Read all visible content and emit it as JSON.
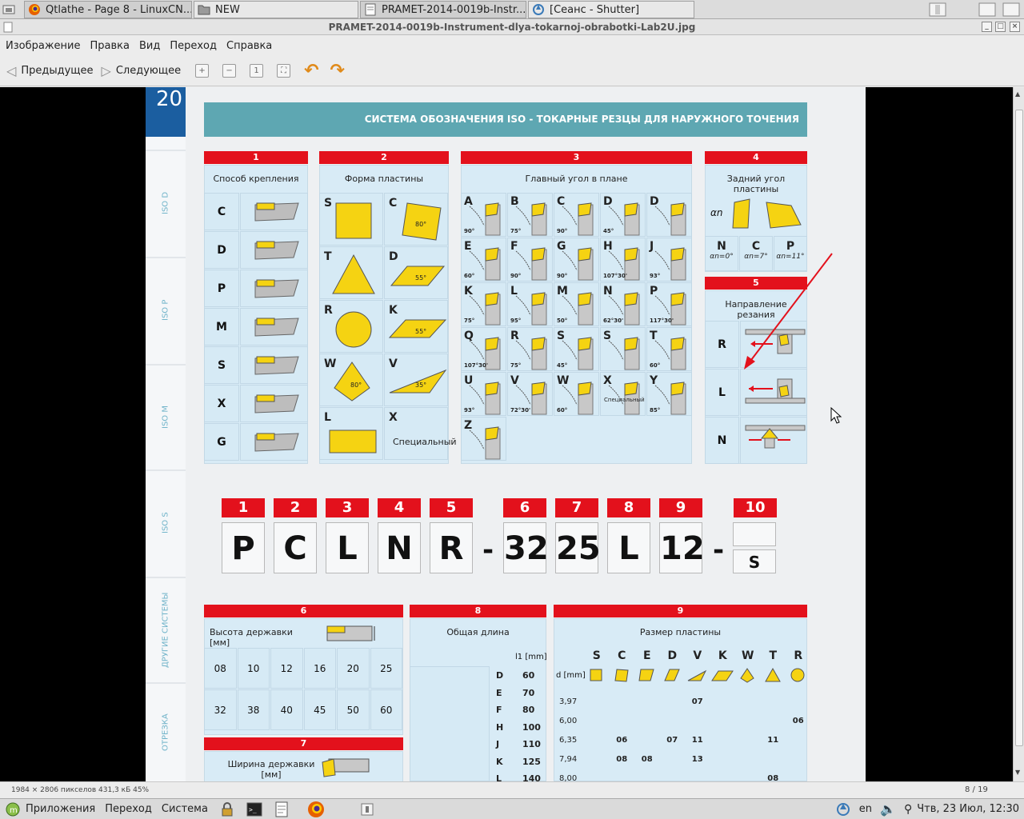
{
  "taskbar_top": {
    "tabs": [
      {
        "label": "Qtlathe - Page 8 - LinuxCN...",
        "icon": "firefox-icon"
      },
      {
        "label": "NEW",
        "icon": "folder-icon"
      },
      {
        "label": "PRAMET-2014-0019b-Instr...",
        "icon": "document-icon"
      },
      {
        "label": "[Сеанс - Shutter]",
        "icon": "shutter-icon"
      }
    ]
  },
  "window": {
    "title": "PRAMET-2014-0019b-Instrument-dlya-tokarnoj-obrabotki-Lab2U.jpg"
  },
  "menu": [
    "Изображение",
    "Правка",
    "Вид",
    "Переход",
    "Справка"
  ],
  "toolbar": {
    "prev_label": "Предыдущее",
    "next_label": "Следующее"
  },
  "status": {
    "info": "1984 × 2806 пикселов  431,3 кБ   45%",
    "page": "8 / 19"
  },
  "bottom_panel": {
    "apps": "Приложения",
    "places": "Переход",
    "system": "Система",
    "lang": "en",
    "datetime": "Чтв, 23 Июл, 12:30"
  },
  "doc": {
    "page_number": "20",
    "banner": "СИСТЕМА ОБОЗНАЧЕНИЯ ISO - ТОКАРНЫЕ РЕЗЦЫ ДЛЯ НАРУЖНОГО ТОЧЕНИЯ",
    "sidebar": [
      "ISO D",
      "ISO P",
      "ISO M",
      "ISO S",
      "ДРУГИЕ СИСТЕМЫ",
      "ОТРЕЗКА"
    ],
    "sections": {
      "s1": {
        "num": "1",
        "title": "Способ крепления",
        "codes": [
          "C",
          "D",
          "P",
          "M",
          "S",
          "X",
          "G"
        ]
      },
      "s2": {
        "num": "2",
        "title": "Форма пластины",
        "codes": [
          "S",
          "C",
          "T",
          "D",
          "R",
          "K",
          "W",
          "V",
          "L",
          "X"
        ],
        "angles": [
          "80°",
          "55°",
          "55°",
          "80°",
          "35°"
        ],
        "special": "Специальный"
      },
      "s3": {
        "num": "3",
        "title": "Главный угол в плане",
        "codes": [
          "A",
          "B",
          "C",
          "D",
          "D",
          "E",
          "F",
          "G",
          "H",
          "J",
          "K",
          "L",
          "M",
          "N",
          "P",
          "Q",
          "R",
          "S",
          "S",
          "T",
          "U",
          "V",
          "W",
          "X",
          "Y",
          "Z"
        ],
        "angles": [
          "90°",
          "75°",
          "90°",
          "45°",
          "",
          "60°",
          "90°",
          "90°",
          "107°30'",
          "93°",
          "75°",
          "95°",
          "50°",
          "62°30'",
          "117°30'",
          "107°30'",
          "75°",
          "45°",
          "",
          "60°",
          "93°",
          "72°30'",
          "60°",
          "",
          "85°",
          ""
        ],
        "special": "Специальный"
      },
      "s4": {
        "num": "4",
        "title": "Задний угол пластины",
        "codes": [
          "N",
          "C",
          "P"
        ],
        "values": [
          "αn=0°",
          "αn=7°",
          "αn=11°"
        ],
        "alpha": "αn"
      },
      "s5": {
        "num": "5",
        "title": "Направление резания",
        "codes": [
          "R",
          "L",
          "N"
        ]
      },
      "s6": {
        "num": "6",
        "title": "Высота державки [мм]",
        "row1": [
          "08",
          "10",
          "12",
          "16",
          "20",
          "25"
        ],
        "row2": [
          "32",
          "38",
          "40",
          "45",
          "50",
          "60"
        ]
      },
      "s7": {
        "num": "7",
        "title": "Ширина державки [мм]"
      },
      "s8": {
        "num": "8",
        "title": "Общая длина",
        "unit": "l1 [mm]",
        "codes": [
          "D",
          "E",
          "F",
          "H",
          "J",
          "K",
          "L"
        ],
        "values": [
          "60",
          "70",
          "80",
          "100",
          "110",
          "125",
          "140"
        ]
      },
      "s9": {
        "num": "9",
        "title": "Размер пластины",
        "unit": "d [mm]",
        "shapes": [
          "S",
          "C",
          "E",
          "D",
          "V",
          "K",
          "W",
          "T",
          "R"
        ],
        "rows": [
          {
            "d": "3,97",
            "vals": [
              "",
              "",
              "",
              "",
              "07",
              "",
              "",
              "",
              ""
            ]
          },
          {
            "d": "6,00",
            "vals": [
              "",
              "",
              "",
              "",
              "",
              "",
              "",
              "",
              "06"
            ]
          },
          {
            "d": "6,35",
            "vals": [
              "",
              "06",
              "",
              "07",
              "11",
              "",
              "",
              "11",
              ""
            ]
          },
          {
            "d": "7,94",
            "vals": [
              "",
              "08",
              "08",
              "",
              "13",
              "",
              "",
              "",
              ""
            ]
          },
          {
            "d": "8,00",
            "vals": [
              "",
              "",
              "",
              "",
              "",
              "",
              "",
              "08",
              ""
            ]
          }
        ]
      }
    },
    "code_example": {
      "numbers": [
        "1",
        "2",
        "3",
        "4",
        "5",
        "6",
        "7",
        "8",
        "9",
        "10"
      ],
      "letters": [
        "P",
        "C",
        "L",
        "N",
        "R",
        "32",
        "25",
        "L",
        "12"
      ],
      "last": "S",
      "dash": "-"
    }
  }
}
